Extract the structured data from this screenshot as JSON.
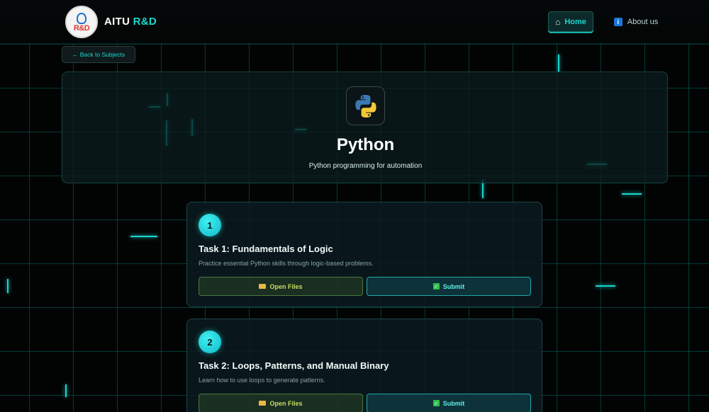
{
  "brand": {
    "name": "AITU",
    "accent": "R&D",
    "logo_text": "R&D"
  },
  "nav": {
    "home": "Home",
    "about": "About us"
  },
  "back_button": "← Back to Subjects",
  "subject": {
    "title": "Python",
    "subtitle": "Python programming for automation"
  },
  "tasks": [
    {
      "number": "1",
      "title": "Task 1: Fundamentals of Logic",
      "description": "Practice essential Python skills through logic-based problems.",
      "open_label": "Open Files",
      "submit_label": "Submit"
    },
    {
      "number": "2",
      "title": "Task 2: Loops, Patterns, and Manual Binary",
      "description": "Learn how to use loops to generate patterns.",
      "open_label": "Open Files",
      "submit_label": "Submit"
    }
  ],
  "icons": {
    "home": "house-icon",
    "about": "info-icon",
    "subject": "python-icon",
    "open": "folder-icon",
    "submit": "check-icon"
  },
  "colors": {
    "accent": "#18d8d0",
    "background": "#020404",
    "open_button": "#c8dc60",
    "submit_button": "#5ef0e8"
  }
}
